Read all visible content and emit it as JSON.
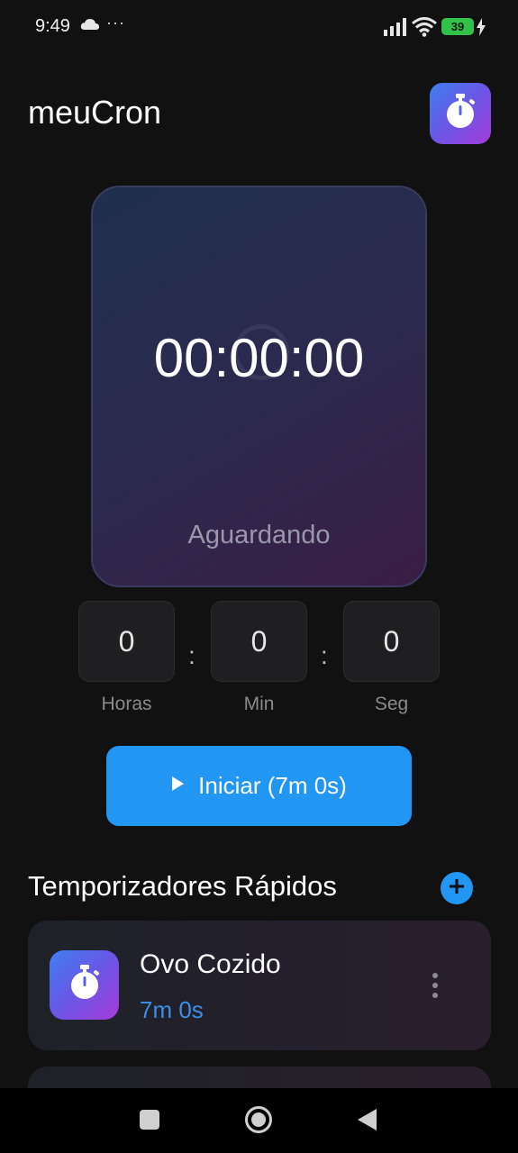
{
  "status_bar": {
    "time": "9:49",
    "more": "···",
    "battery": "39",
    "icons": [
      "cloud-icon",
      "signal-icon",
      "wifi-icon",
      "battery-icon",
      "charging-bolt-icon"
    ]
  },
  "header": {
    "title": "meuCron",
    "logo_icon": "stopwatch-icon"
  },
  "timer": {
    "display": "00:00:00",
    "status": "Aguardando"
  },
  "inputs": {
    "hours": {
      "value": "0",
      "label": "Horas"
    },
    "minutes": {
      "value": "0",
      "label": "Min"
    },
    "seconds": {
      "value": "0",
      "label": "Seg"
    },
    "separator": ":"
  },
  "start_button": {
    "label": "Iniciar (7m 0s)",
    "icon": "play-icon"
  },
  "quick_timers": {
    "title": "Temporizadores Rápidos",
    "add_icon": "plus-icon",
    "items": [
      {
        "name": "Ovo Cozido",
        "duration": "7m 0s",
        "icon": "stopwatch-icon"
      }
    ]
  },
  "nav_bar": {
    "icons": [
      "recents-icon",
      "home-icon",
      "back-icon"
    ]
  },
  "colors": {
    "accent": "#2196f3",
    "background": "#111112",
    "gradient_start": "#3f7ff0",
    "gradient_end": "#a53cd8"
  }
}
